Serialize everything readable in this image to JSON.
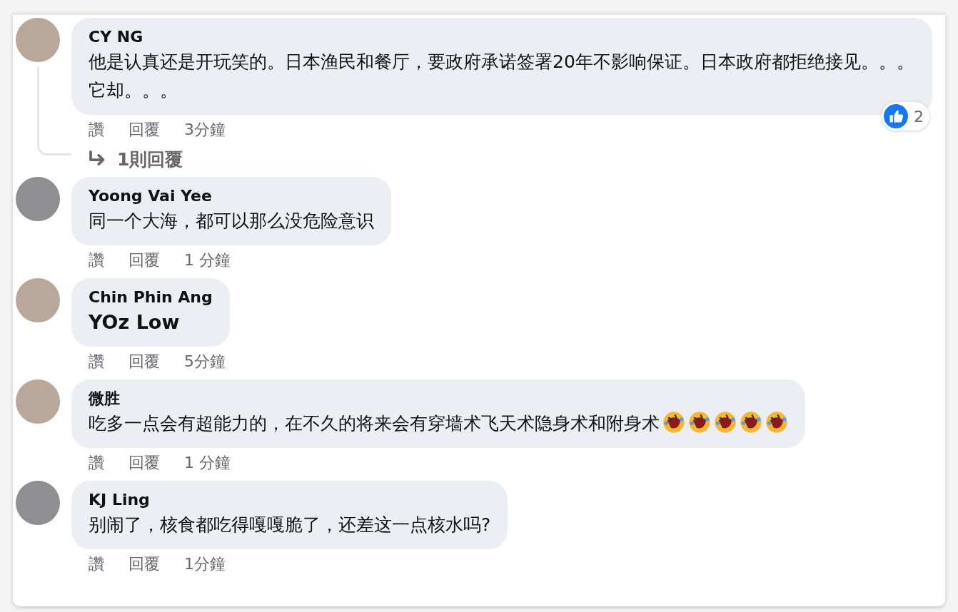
{
  "comments": [
    {
      "author": "CY NG",
      "text": "他是认真还是开玩笑的。日本渔民和餐厅，要政府承诺签署20年不影响保证。日本政府都拒绝接见。。。它却。。。",
      "like": "讚",
      "reply": "回覆",
      "time": "3分鐘",
      "reaction_count": "2",
      "replies_link": "1則回覆"
    },
    {
      "author": "Yoong Vai Yee",
      "text": "同一个大海，都可以那么没危险意识",
      "like": "讚",
      "reply": "回覆",
      "time": "1 分鐘"
    },
    {
      "author": "Chin Phin Ang",
      "text": "YOz Low",
      "bold_text": true,
      "like": "讚",
      "reply": "回覆",
      "time": "5分鐘"
    },
    {
      "author": "微胜",
      "text": "吃多一点会有超能力的，在不久的将来会有穿墙术飞天术隐身术和附身术",
      "emojis": [
        {
          "kind": "rolling_laugh"
        },
        {
          "kind": "rolling_laugh"
        },
        {
          "kind": "rolling_laugh"
        },
        {
          "kind": "rolling_laugh"
        },
        {
          "kind": "rolling_laugh"
        }
      ],
      "like": "讚",
      "reply": "回覆",
      "time": "1 分鐘"
    },
    {
      "author": "KJ Ling",
      "text": "别闹了，核食都吃得嘎嘎脆了，还差这一点核水吗?",
      "like": "讚",
      "reply": "回覆",
      "time": "1分鐘"
    }
  ]
}
